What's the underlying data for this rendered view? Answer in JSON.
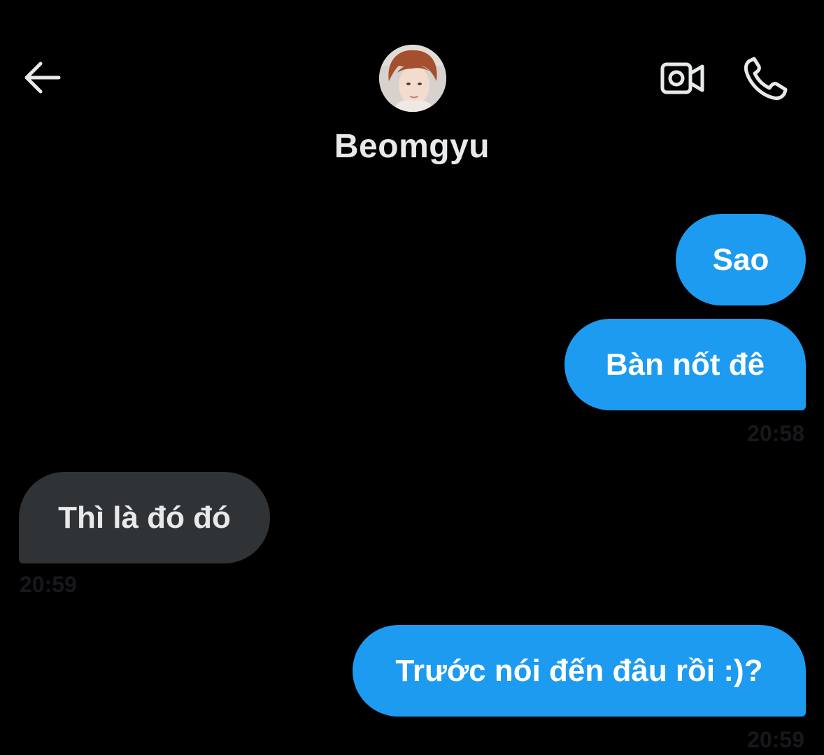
{
  "header": {
    "back_icon": "arrow-left-icon",
    "contact_name": "Beomgyu",
    "avatar_icon": "avatar-photo",
    "video_call_icon": "video-camera-icon",
    "voice_call_icon": "phone-icon"
  },
  "messages": [
    {
      "direction": "sent",
      "text": "Sao"
    },
    {
      "direction": "sent",
      "text": "Bàn nốt đê",
      "time": "20:58"
    },
    {
      "direction": "received",
      "text": "Thì là đó đó",
      "time": "20:59"
    },
    {
      "direction": "sent",
      "text": "Trước nói đến đâu rồi :)?",
      "time": "20:59"
    }
  ],
  "colors": {
    "background": "#000000",
    "sent_bubble": "#1d9bf0",
    "received_bubble": "#2f3336",
    "text_primary": "#e7e9ea"
  }
}
